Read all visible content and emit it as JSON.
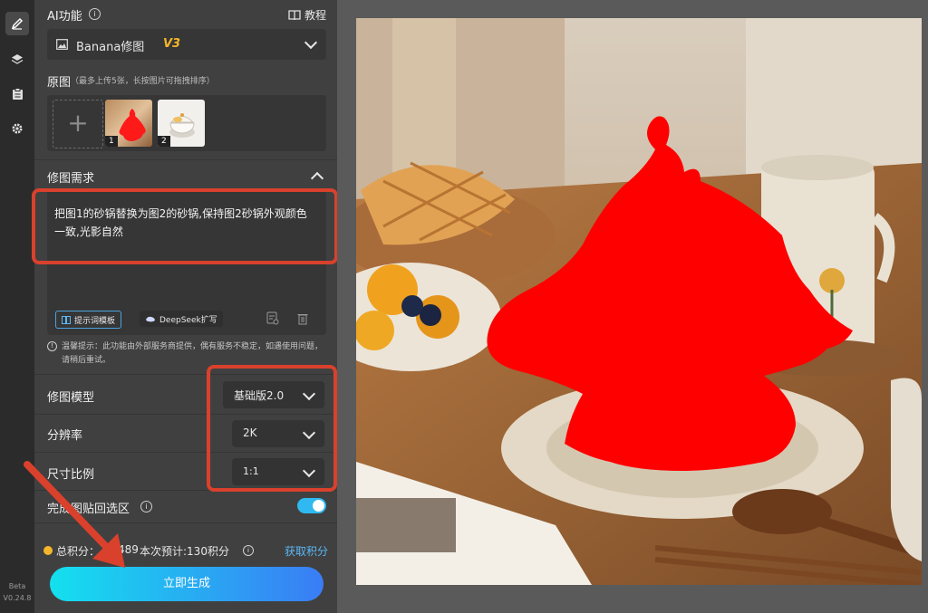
{
  "rail": {
    "beta_label": "Beta",
    "version": "V0.24.8"
  },
  "header": {
    "title": "AI功能",
    "tutorial_label": "教程"
  },
  "feature_select": {
    "name": "Banana修图",
    "badge": "V3"
  },
  "source": {
    "title": "原图",
    "hint": "（最多上传5张，长按图片可拖拽排序）",
    "thumbnails": [
      {
        "index": "1"
      },
      {
        "index": "2"
      }
    ]
  },
  "request": {
    "title": "修图需求",
    "text": "把图1的砂锅替换为图2的砂锅,保持图2砂锅外观颜色一致,光影自然",
    "template_label": "提示词模板",
    "deepseek_label": "DeepSeek扩写"
  },
  "notice": "温馨提示：此功能由外部服务商提供，偶有服务不稳定，如遇使用问题，请稍后重试。",
  "settings": [
    {
      "label": "修图模型",
      "value": "基础版2.0"
    },
    {
      "label": "分辨率",
      "value": "2K"
    },
    {
      "label": "尺寸比例",
      "value": "1:1"
    }
  ],
  "paste_back": {
    "label": "完成图贴回选区",
    "enabled": true
  },
  "points": {
    "total_label": "总积分：",
    "total_value": "489",
    "estimate_label": "本次预计:130积分",
    "get_points": "获取积分"
  },
  "generate_button": "立即生成",
  "colors": {
    "accent": "#2fb9f0",
    "red_annotation": "#d9412d",
    "mask": "#ff0000",
    "points_link": "#5ab8f7"
  }
}
